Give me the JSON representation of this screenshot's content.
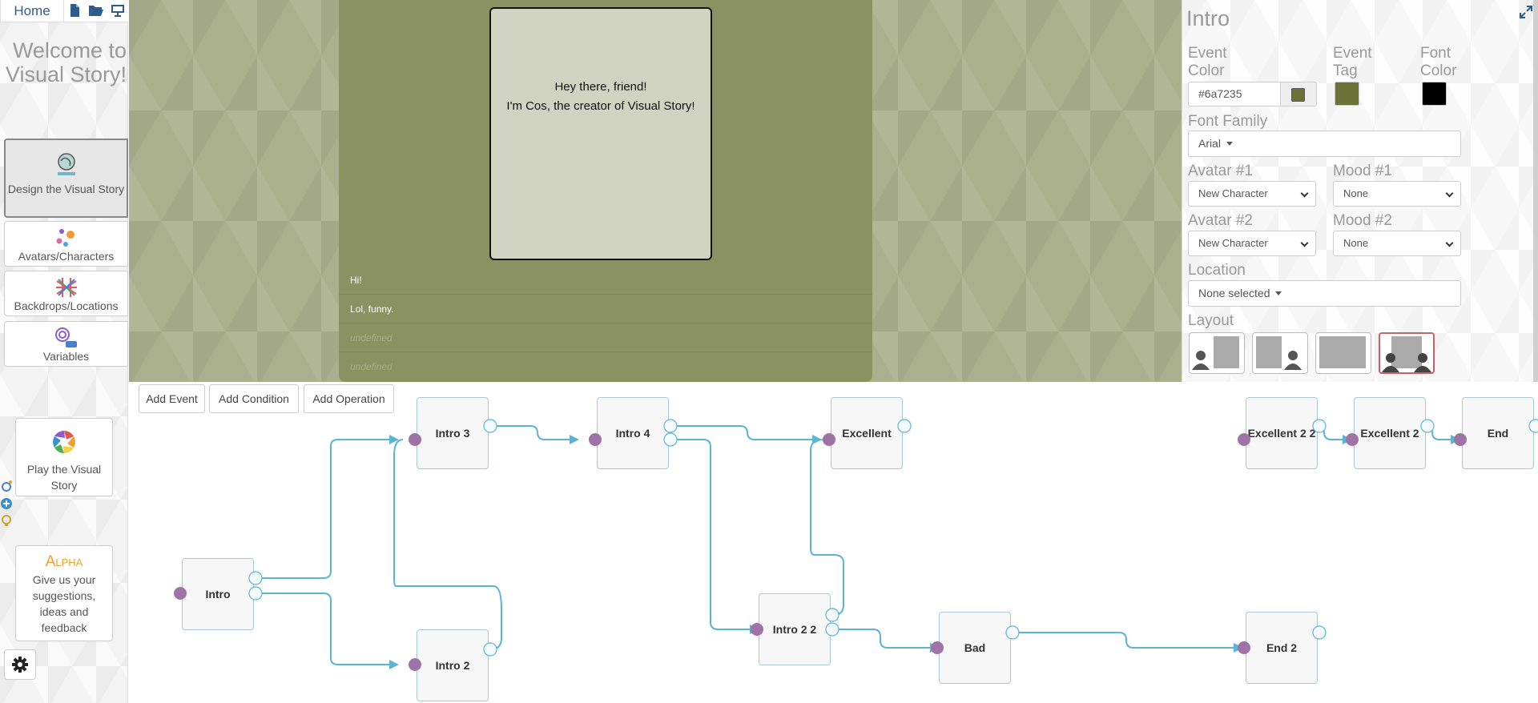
{
  "sidebar": {
    "home_label": "Home",
    "welcome": "Welcome to Visual Story!",
    "nav": [
      {
        "label": "Design the Visual Story",
        "icon": "design-icon"
      },
      {
        "label": "Avatars/Characters",
        "icon": "avatars-icon"
      },
      {
        "label": "Backdrops/Locations",
        "icon": "backdrops-icon"
      },
      {
        "label": "Variables",
        "icon": "variables-icon"
      }
    ],
    "play_label": "Play the Visual Story",
    "alpha_title": "Alpha",
    "alpha_text": "Give us your suggestions, ideas and feedback"
  },
  "preview": {
    "dialog_line1": "Hey there, friend!",
    "dialog_line2": "I'm Cos, the creator of Visual Story!",
    "choices": [
      "Hi!",
      "Lol, funny.",
      "undefined",
      "undefined"
    ]
  },
  "panel": {
    "title": "Intro",
    "event_color_label": "Event Color",
    "event_color_value": "#6a7235",
    "event_tag_label": "Event Tag",
    "font_color_label": "Font Color",
    "font_family_label": "Font Family",
    "font_family_value": "Arial",
    "avatar1_label": "Avatar #1",
    "avatar1_value": "New Character",
    "mood1_label": "Mood #1",
    "mood1_value": "None",
    "avatar2_label": "Avatar #2",
    "avatar2_value": "New Character",
    "mood2_label": "Mood #2",
    "mood2_value": "None",
    "location_label": "Location",
    "location_value": "None selected",
    "layout_label": "Layout",
    "colors": {
      "event": "#6a7235",
      "tag": "#6a7235",
      "font": "#000000",
      "selected_layout_border": "#c0656a"
    }
  },
  "flow": {
    "toolbar": {
      "add_event": "Add Event",
      "add_condition": "Add Condition",
      "add_operation": "Add Operation"
    },
    "nodes": [
      {
        "id": "intro",
        "label": "Intro"
      },
      {
        "id": "intro3",
        "label": "Intro 3"
      },
      {
        "id": "intro2",
        "label": "Intro 2"
      },
      {
        "id": "intro4",
        "label": "Intro 4"
      },
      {
        "id": "excellent",
        "label": "Excellent"
      },
      {
        "id": "intro22",
        "label": "Intro 2 2"
      },
      {
        "id": "bad",
        "label": "Bad"
      },
      {
        "id": "excellent22",
        "label": "Excellent 2 2"
      },
      {
        "id": "excellent2",
        "label": "Excellent 2"
      },
      {
        "id": "end",
        "label": "End"
      },
      {
        "id": "end2",
        "label": "End 2"
      }
    ],
    "colors": {
      "edge": "#5bb4d6",
      "input_port": "#a073a8",
      "node_border": "#a9c9d8"
    }
  }
}
